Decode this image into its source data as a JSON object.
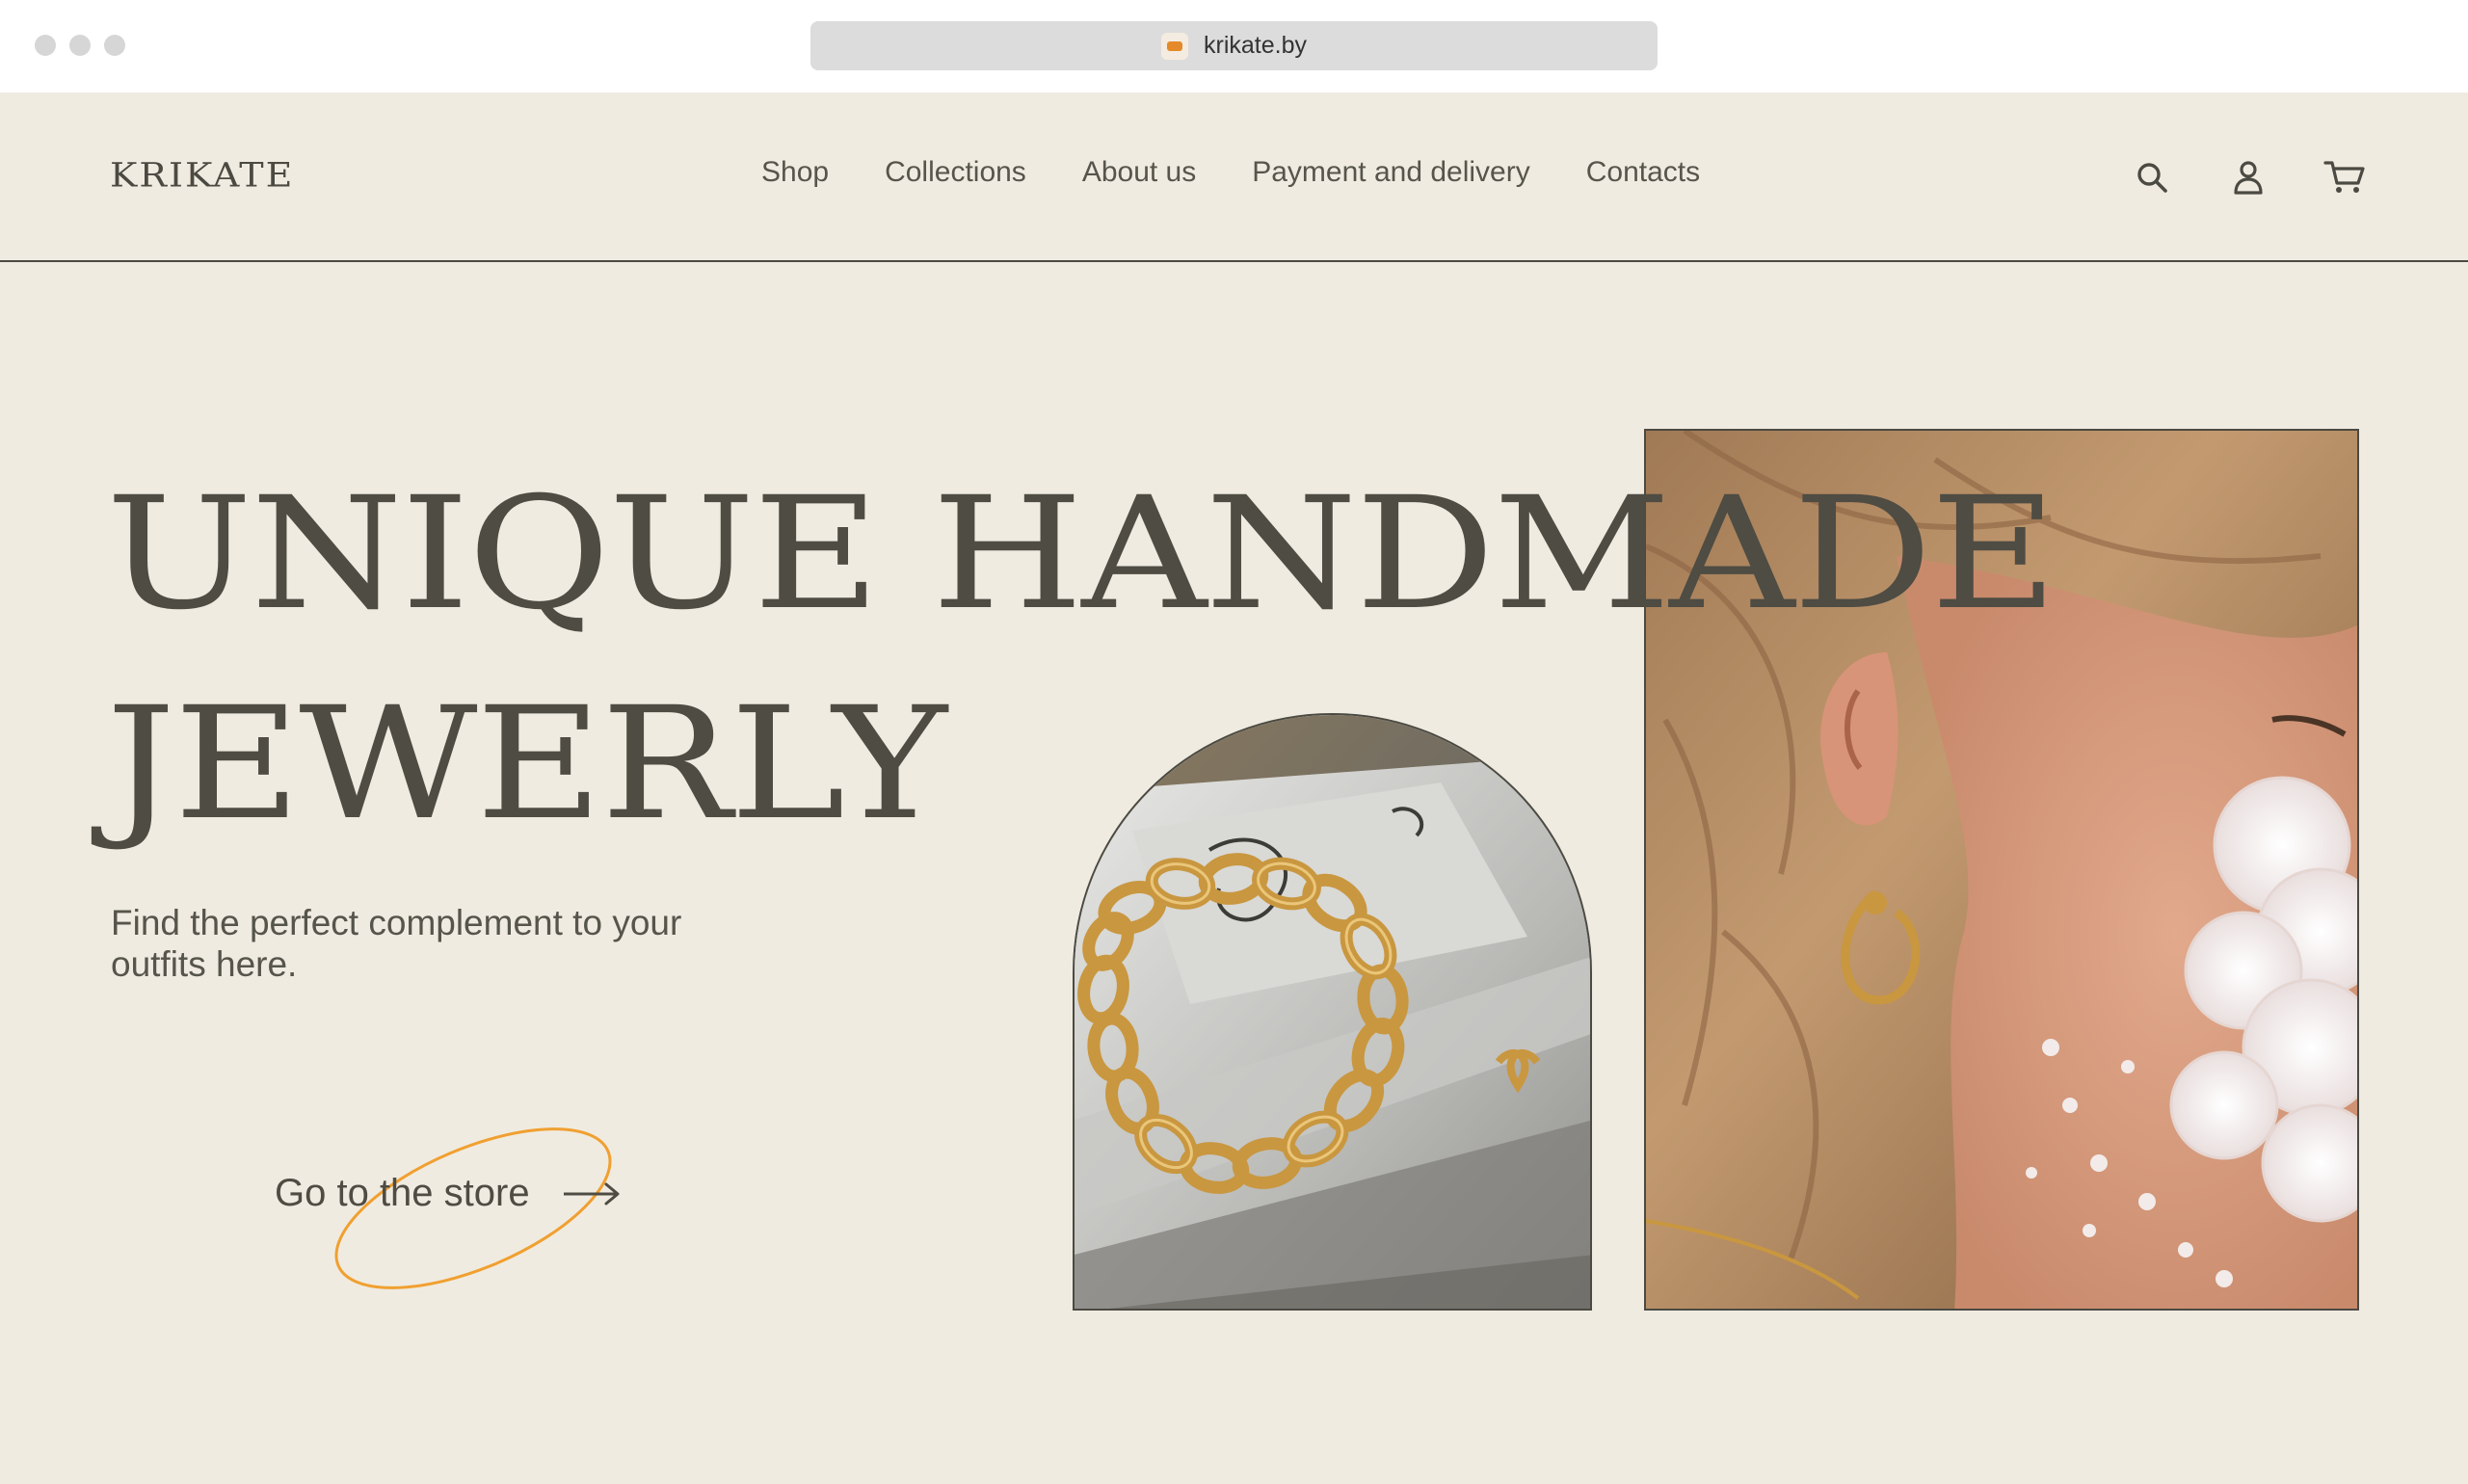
{
  "browser": {
    "url": "krikate.by",
    "favicon_icon": "krikate-favicon"
  },
  "header": {
    "logo": "KRIKATE",
    "nav": [
      "Shop",
      "Collections",
      "About us",
      "Payment and delivery",
      "Contacts"
    ],
    "icons": [
      "search-icon",
      "user-icon",
      "cart-icon"
    ]
  },
  "hero": {
    "title_line1": "UNIQUE HANDMADE",
    "title_line2": "JEWERLY",
    "subtitle": "Find the perfect complement to your outfits here.",
    "cta_label": "Go to the store"
  },
  "colors": {
    "background": "#f0ebe1",
    "text": "#4e4c43",
    "accent": "#f0a030",
    "gold": "#c9973f"
  }
}
